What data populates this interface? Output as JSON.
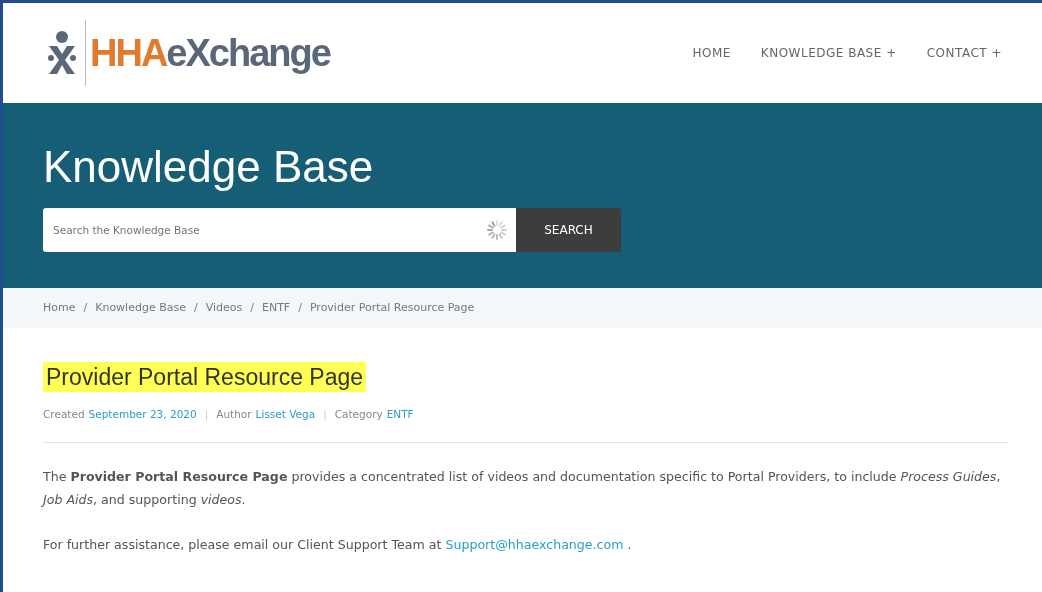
{
  "header": {
    "logo": {
      "brand_primary": "HHA",
      "brand_secondary": "eXchange"
    },
    "nav": [
      {
        "label": "HOME",
        "has_submenu": false
      },
      {
        "label": "KNOWLEDGE BASE",
        "has_submenu": true,
        "submenu_mark": "+"
      },
      {
        "label": "CONTACT",
        "has_submenu": true,
        "submenu_mark": "+"
      }
    ]
  },
  "banner": {
    "title": "Knowledge Base",
    "search": {
      "placeholder": "Search the Knowledge Base",
      "loading": true
    },
    "search_button": "SEARCH"
  },
  "breadcrumb": {
    "separator": "/",
    "items": [
      "Home",
      "Knowledge Base",
      "Videos",
      "ENTF",
      "Provider Portal Resource Page"
    ]
  },
  "article": {
    "title": "Provider Portal Resource Page",
    "title_highlighted": true,
    "meta_separator": "|",
    "meta": [
      {
        "label": "Created",
        "value": "September 23, 2020"
      },
      {
        "label": "Author",
        "value": "Lisset Vega"
      },
      {
        "label": "Category",
        "value": "ENTF"
      }
    ],
    "paragraphs": [
      {
        "text": "The **Provider Portal Resource Page** provides a concentrated list of videos and documentation specific to Portal Providers, to include *Process Guides*, *Job Aids*, and supporting *videos*."
      },
      {
        "text": "For further assistance, please email our Client Support Team at",
        "link": "Support@hhaexchange.com",
        "after": "."
      }
    ]
  }
}
